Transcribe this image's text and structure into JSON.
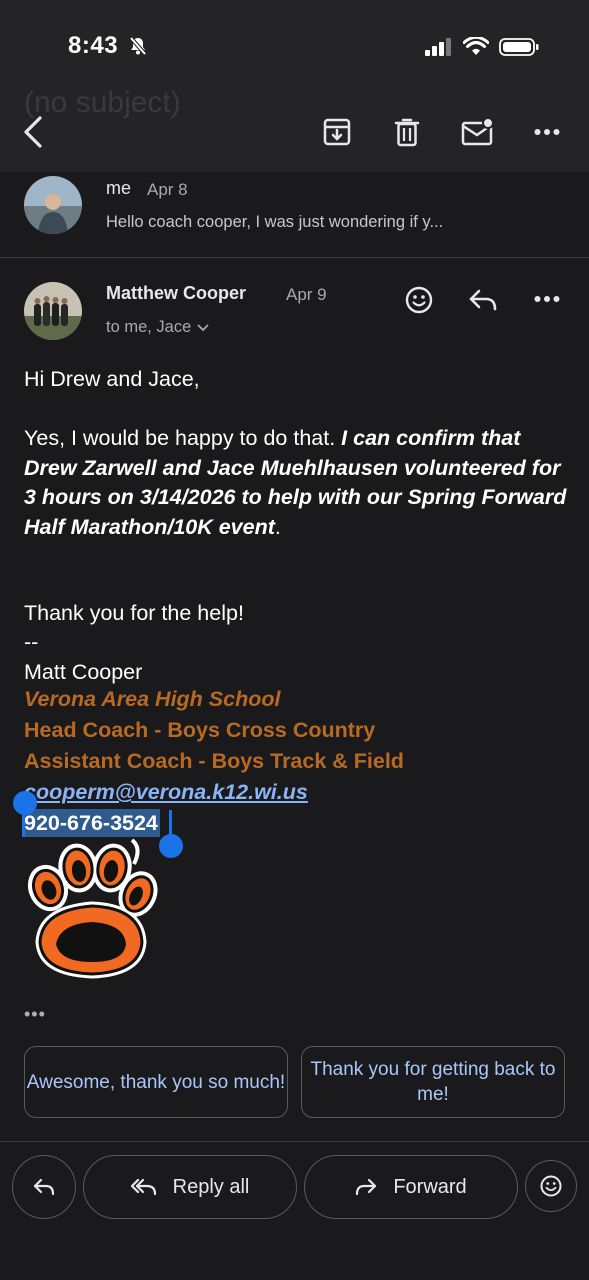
{
  "status_bar": {
    "time": "8:43"
  },
  "header": {
    "ghost_subject": "(no subject)"
  },
  "thread": {
    "collapsed": {
      "sender": "me",
      "date": "Apr 8",
      "snippet": "Hello coach cooper, I was just wondering if y..."
    },
    "expanded": {
      "sender": "Matthew Cooper",
      "date": "Apr 9",
      "recipients": "to me, Jace",
      "greeting": "Hi Drew and Jace,",
      "para_plain": "Yes, I would be happy to do that. ",
      "para_bold": "I can confirm that Drew Zarwell and Jace Muehlhausen volunteered for 3 hours on 3/14/2026 to help with our Spring Forward Half Marathon/10K event",
      "para_end": ".",
      "thanks": "Thank you for the help!",
      "separator": "--",
      "sig_name": "Matt Cooper",
      "sig_school": "Verona Area High School",
      "sig_title1": "Head Coach - Boys Cross Country",
      "sig_title2": "Assistant Coach - Boys Track & Field",
      "sig_email": "cooperm@verona.k12.wi.us",
      "sig_phone": "920-676-3524",
      "more_indicator": "•••"
    }
  },
  "smart_replies": [
    "Awesome, thank you so much!",
    "Thank you for getting back to me!"
  ],
  "bottom_bar": {
    "reply_all": "Reply all",
    "forward": "Forward"
  },
  "colors": {
    "background": "#1a1a1c",
    "signature_orange": "#b96a22",
    "link_blue": "#8ab4f8",
    "chip_text": "#a8c7fa",
    "selection_handle": "#1a73e8"
  },
  "icons": [
    "back-arrow-icon",
    "archive-icon",
    "trash-icon",
    "mark-unread-icon",
    "more-icon",
    "emoji-icon",
    "reply-icon",
    "reply-all-icon",
    "forward-icon",
    "paw-logo"
  ]
}
